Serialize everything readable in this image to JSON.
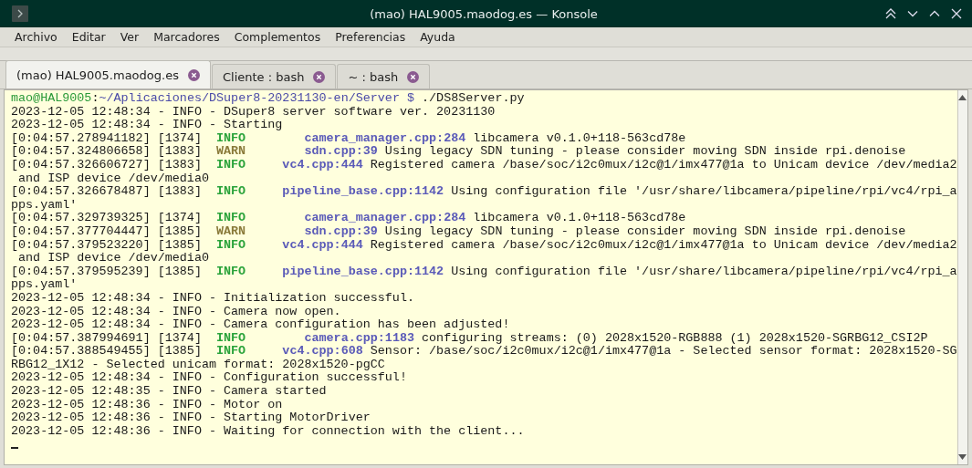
{
  "window": {
    "title": "(mao) HAL9005.maodog.es — Konsole"
  },
  "menu": [
    "Archivo",
    "Editar",
    "Ver",
    "Marcadores",
    "Complementos",
    "Preferencias",
    "Ayuda"
  ],
  "tabs": [
    {
      "label": "(mao) HAL9005.maodog.es",
      "selected": true
    },
    {
      "label": "Cliente : bash",
      "selected": false
    },
    {
      "label": "~ : bash",
      "selected": false
    }
  ],
  "terminal": {
    "cursor_visible": true,
    "lines": [
      [
        {
          "kind": "user",
          "text": "mao@HAL9005"
        },
        {
          "kind": "plain",
          "text": ":"
        },
        {
          "kind": "path",
          "text": "~/Aplicaciones/DSuper8-20231130-en/Server $"
        },
        {
          "kind": "plain",
          "text": " ./DS8Server.py"
        }
      ],
      [
        {
          "kind": "plain",
          "text": "2023-12-05 12:48:34 - INFO - DSuper8 server software ver. 20231130"
        }
      ],
      [
        {
          "kind": "plain",
          "text": "2023-12-05 12:48:34 - INFO - Starting"
        }
      ],
      [
        {
          "kind": "plain",
          "text": "[0:04:57.278941182] [1374]  "
        },
        {
          "kind": "info",
          "text": "INFO"
        },
        {
          "kind": "source_far",
          "text": "camera_manager.cpp:284"
        },
        {
          "kind": "plain",
          "text": " libcamera v0.1.0+118-563cd78e"
        }
      ],
      [
        {
          "kind": "plain",
          "text": "[0:04:57.324806658] [1383]  "
        },
        {
          "kind": "warn",
          "text": "WARN"
        },
        {
          "kind": "source_far",
          "text": "sdn.cpp:39"
        },
        {
          "kind": "plain",
          "text": " Using legacy SDN tuning - please consider moving SDN inside rpi.denoise"
        }
      ],
      [
        {
          "kind": "plain",
          "text": "[0:04:57.326606727] [1383]  "
        },
        {
          "kind": "info",
          "text": "INFO"
        },
        {
          "kind": "source_near",
          "text": "vc4.cpp:444"
        },
        {
          "kind": "plain",
          "text": " Registered camera /base/soc/i2c0mux/i2c@1/imx477@1a to Unicam device /dev/media2"
        }
      ],
      [
        {
          "kind": "plain",
          "text": " and ISP device /dev/media0"
        }
      ],
      [
        {
          "kind": "plain",
          "text": "[0:04:57.326678487] [1383]  "
        },
        {
          "kind": "info",
          "text": "INFO"
        },
        {
          "kind": "source_near",
          "text": "pipeline_base.cpp:1142"
        },
        {
          "kind": "plain",
          "text": " Using configuration file '/usr/share/libcamera/pipeline/rpi/vc4/rpi_a"
        }
      ],
      [
        {
          "kind": "plain",
          "text": "pps.yaml'"
        }
      ],
      [
        {
          "kind": "plain",
          "text": "[0:04:57.329739325] [1374]  "
        },
        {
          "kind": "info",
          "text": "INFO"
        },
        {
          "kind": "source_far",
          "text": "camera_manager.cpp:284"
        },
        {
          "kind": "plain",
          "text": " libcamera v0.1.0+118-563cd78e"
        }
      ],
      [
        {
          "kind": "plain",
          "text": "[0:04:57.377704447] [1385]  "
        },
        {
          "kind": "warn",
          "text": "WARN"
        },
        {
          "kind": "source_far",
          "text": "sdn.cpp:39"
        },
        {
          "kind": "plain",
          "text": " Using legacy SDN tuning - please consider moving SDN inside rpi.denoise"
        }
      ],
      [
        {
          "kind": "plain",
          "text": "[0:04:57.379523220] [1385]  "
        },
        {
          "kind": "info",
          "text": "INFO"
        },
        {
          "kind": "source_near",
          "text": "vc4.cpp:444"
        },
        {
          "kind": "plain",
          "text": " Registered camera /base/soc/i2c0mux/i2c@1/imx477@1a to Unicam device /dev/media2"
        }
      ],
      [
        {
          "kind": "plain",
          "text": " and ISP device /dev/media0"
        }
      ],
      [
        {
          "kind": "plain",
          "text": "[0:04:57.379595239] [1385]  "
        },
        {
          "kind": "info",
          "text": "INFO"
        },
        {
          "kind": "source_near",
          "text": "pipeline_base.cpp:1142"
        },
        {
          "kind": "plain",
          "text": " Using configuration file '/usr/share/libcamera/pipeline/rpi/vc4/rpi_a"
        }
      ],
      [
        {
          "kind": "plain",
          "text": "pps.yaml'"
        }
      ],
      [
        {
          "kind": "plain",
          "text": "2023-12-05 12:48:34 - INFO - Initialization successful."
        }
      ],
      [
        {
          "kind": "plain",
          "text": "2023-12-05 12:48:34 - INFO - Camera now open."
        }
      ],
      [
        {
          "kind": "plain",
          "text": "2023-12-05 12:48:34 - INFO - Camera configuration has been adjusted!"
        }
      ],
      [
        {
          "kind": "plain",
          "text": "[0:04:57.387994691] [1374]  "
        },
        {
          "kind": "info",
          "text": "INFO"
        },
        {
          "kind": "source_far",
          "text": "camera.cpp:1183"
        },
        {
          "kind": "plain",
          "text": " configuring streams: (0) 2028x1520-RGB888 (1) 2028x1520-SGRBG12_CSI2P"
        }
      ],
      [
        {
          "kind": "plain",
          "text": "[0:04:57.388549455] [1385]  "
        },
        {
          "kind": "info",
          "text": "INFO"
        },
        {
          "kind": "source_near",
          "text": "vc4.cpp:608"
        },
        {
          "kind": "plain",
          "text": " Sensor: /base/soc/i2c0mux/i2c@1/imx477@1a - Selected sensor format: 2028x1520-SG"
        }
      ],
      [
        {
          "kind": "plain",
          "text": "RBG12_1X12 - Selected unicam format: 2028x1520-pgCC"
        }
      ],
      [
        {
          "kind": "plain",
          "text": "2023-12-05 12:48:34 - INFO - Configuration successful!"
        }
      ],
      [
        {
          "kind": "plain",
          "text": "2023-12-05 12:48:35 - INFO - Camera started"
        }
      ],
      [
        {
          "kind": "plain",
          "text": "2023-12-05 12:48:36 - INFO - Motor on"
        }
      ],
      [
        {
          "kind": "plain",
          "text": "2023-12-05 12:48:36 - INFO - Starting MotorDriver"
        }
      ],
      [
        {
          "kind": "plain",
          "text": "2023-12-05 12:48:36 - INFO - Waiting for connection with the client..."
        }
      ]
    ]
  }
}
